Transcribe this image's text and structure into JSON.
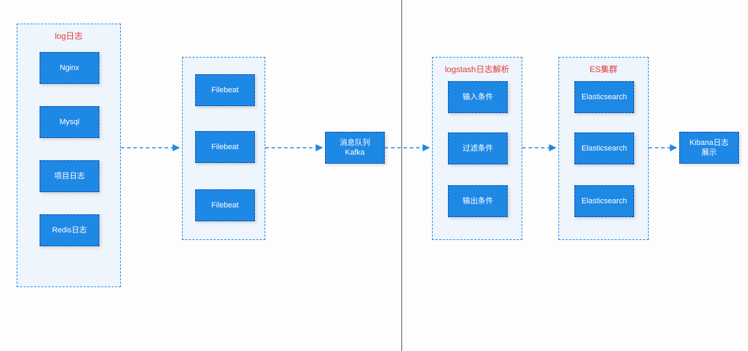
{
  "groups": {
    "log": {
      "title": "log日志",
      "items": [
        "Nginx",
        "Mysql",
        "项目日志",
        "Redis日志"
      ]
    },
    "filebeat": {
      "title": "",
      "items": [
        "Filebeat",
        "Filebeat",
        "Filebeat"
      ]
    },
    "logstash": {
      "title": "logstash日志解析",
      "items": [
        "输入条件",
        "过滤条件",
        "输出条件"
      ]
    },
    "es": {
      "title": "ES集群",
      "items": [
        "Elasticsearch",
        "Elasticsearch",
        "Elasticsearch"
      ]
    }
  },
  "nodes": {
    "kafka": "消息队列\nKafka",
    "kibana": "Kibana日志\n展示"
  },
  "chart_data": {
    "type": "flow-diagram",
    "groups": [
      {
        "id": "log",
        "title": "log日志",
        "items": [
          "Nginx",
          "Mysql",
          "项目日志",
          "Redis日志"
        ]
      },
      {
        "id": "filebeat",
        "title": "",
        "items": [
          "Filebeat",
          "Filebeat",
          "Filebeat"
        ]
      },
      {
        "id": "kafka",
        "title": "",
        "items": [
          "消息队列 Kafka"
        ]
      },
      {
        "id": "logstash",
        "title": "logstash日志解析",
        "items": [
          "输入条件",
          "过滤条件",
          "输出条件"
        ]
      },
      {
        "id": "es",
        "title": "ES集群",
        "items": [
          "Elasticsearch",
          "Elasticsearch",
          "Elasticsearch"
        ]
      },
      {
        "id": "kibana",
        "title": "",
        "items": [
          "Kibana日志展示"
        ]
      }
    ],
    "edges": [
      [
        "log",
        "filebeat"
      ],
      [
        "filebeat",
        "kafka"
      ],
      [
        "kafka",
        "logstash"
      ],
      [
        "logstash",
        "es"
      ],
      [
        "es",
        "kibana"
      ]
    ],
    "colors": {
      "node_fill": "#1e88e5",
      "node_text": "#ffffff",
      "group_border": "#1e88e5",
      "group_fill": "#eef5fc",
      "title_text": "#e53935"
    }
  }
}
